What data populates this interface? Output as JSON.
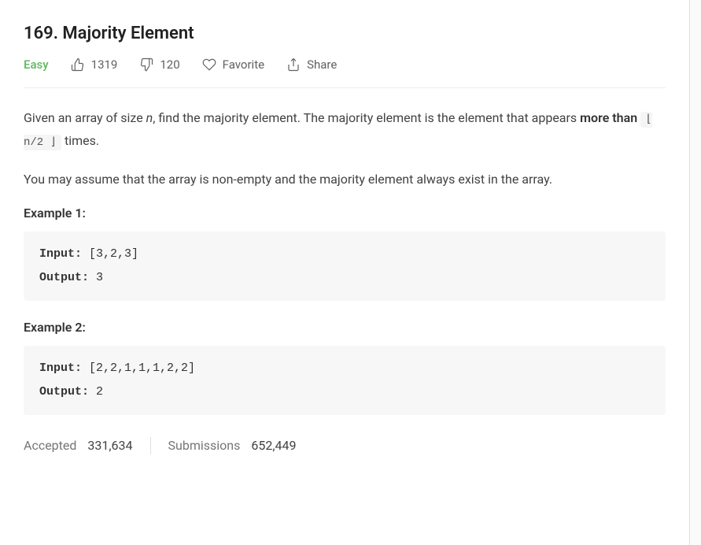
{
  "title": "169. Majority Element",
  "difficulty": "Easy",
  "likes": "1319",
  "dislikes": "120",
  "favorite_label": "Favorite",
  "share_label": "Share",
  "description": {
    "p1_pre": "Given an array of size ",
    "p1_var": "n",
    "p1_mid": ", find the majority element. The majority element is the element that appears ",
    "p1_strong": "more than",
    "p1_code": "⌊ n/2 ⌋",
    "p1_post": " times.",
    "p2": "You may assume that the array is non-empty and the majority element always exist in the array."
  },
  "examples": [
    {
      "label": "Example 1:",
      "input_kw": "Input:",
      "input_val": " [3,2,3]",
      "output_kw": "Output:",
      "output_val": " 3"
    },
    {
      "label": "Example 2:",
      "input_kw": "Input:",
      "input_val": " [2,2,1,1,1,2,2]",
      "output_kw": "Output:",
      "output_val": " 2"
    }
  ],
  "stats": {
    "accepted_label": "Accepted",
    "accepted_value": "331,634",
    "submissions_label": "Submissions",
    "submissions_value": "652,449"
  }
}
